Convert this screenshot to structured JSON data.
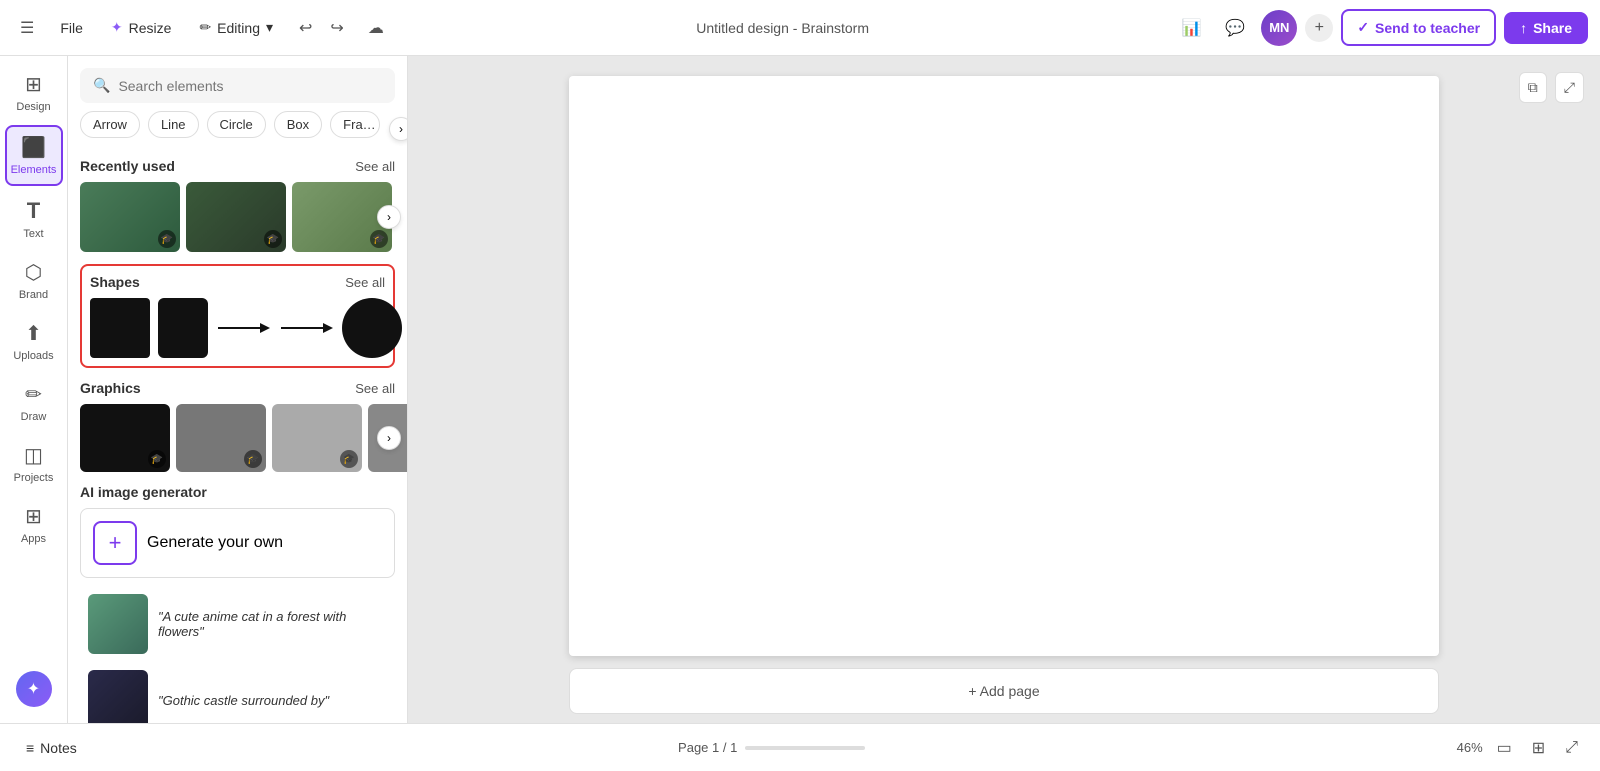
{
  "topbar": {
    "hamburger": "☰",
    "file_label": "File",
    "resize_label": "Resize",
    "resize_icon": "✦",
    "editing_label": "Editing",
    "editing_icon": "✏",
    "undo_icon": "↩",
    "redo_icon": "↪",
    "cloud_icon": "☁",
    "title": "Untitled design - Brainstorm",
    "avatar_initials": "MN",
    "plus_icon": "+",
    "chart_icon": "📊",
    "comment_icon": "💬",
    "send_teacher_icon": "✓",
    "send_teacher_label": "Send to teacher",
    "share_icon": "↑",
    "share_label": "Share"
  },
  "sidebar_nav": {
    "items": [
      {
        "id": "design",
        "icon": "⊞",
        "label": "Design",
        "active": false
      },
      {
        "id": "elements",
        "icon": "⬛",
        "label": "Elements",
        "active": true
      },
      {
        "id": "text",
        "icon": "T",
        "label": "Text",
        "active": false
      },
      {
        "id": "brand",
        "icon": "⬡",
        "label": "Brand",
        "active": false
      },
      {
        "id": "uploads",
        "icon": "↑",
        "label": "Uploads",
        "active": false
      },
      {
        "id": "draw",
        "icon": "✏",
        "label": "Draw",
        "active": false
      },
      {
        "id": "projects",
        "icon": "◫",
        "label": "Projects",
        "active": false
      },
      {
        "id": "apps",
        "icon": "⊞",
        "label": "Apps",
        "active": false
      }
    ],
    "magic_icon": "✦"
  },
  "elements_panel": {
    "search_placeholder": "Search elements",
    "filter_chips": [
      {
        "label": "Arrow"
      },
      {
        "label": "Line"
      },
      {
        "label": "Circle"
      },
      {
        "label": "Box"
      },
      {
        "label": "Frame"
      }
    ],
    "recently_used": {
      "title": "Recently used",
      "see_all": "See all",
      "items": [
        {
          "bg": "#4a7c59",
          "badge": "🎓"
        },
        {
          "bg": "#3a5a3a",
          "badge": "🎓"
        },
        {
          "bg": "#7a9a6a",
          "badge": "🎓"
        }
      ]
    },
    "shapes": {
      "title": "Shapes",
      "see_all": "See all",
      "highlighted": true
    },
    "graphics": {
      "title": "Graphics",
      "see_all": "See all",
      "items": [
        {
          "bg": "#111",
          "badge": "🎓"
        },
        {
          "bg": "#777",
          "badge": "🎓"
        },
        {
          "bg": "#aaa",
          "badge": "🎓"
        },
        {
          "bg": "#999"
        }
      ]
    },
    "ai_section": {
      "title": "AI image generator",
      "generate_label": "Generate your own",
      "presets": [
        {
          "label": "\"A cute anime cat in a forest with flowers\""
        },
        {
          "label": "\"Gothic castle surrounded by\""
        }
      ]
    }
  },
  "canvas": {
    "copy_icon": "⧉",
    "expand_icon": "⤢"
  },
  "bottom_bar": {
    "notes_icon": "≡",
    "notes_label": "Notes",
    "page_info": "Page 1 / 1",
    "zoom_pct": "46%",
    "desktop_icon": "▭",
    "grid_icon": "⊞",
    "fullscreen_icon": "⤢"
  },
  "add_page": {
    "label": "+ Add page"
  }
}
